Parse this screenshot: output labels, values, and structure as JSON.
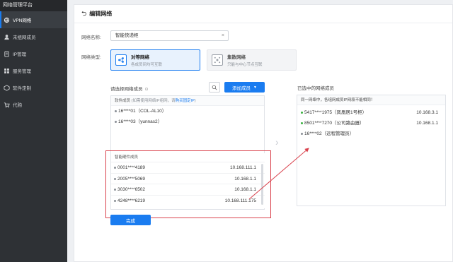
{
  "app": {
    "brand": "网络管理平台"
  },
  "sidebar": {
    "items": [
      {
        "label": "VPN网络",
        "icon": "vpn-icon",
        "active": true
      },
      {
        "label": "未组网成员",
        "icon": "user-icon",
        "active": false
      },
      {
        "label": "IP管理",
        "icon": "ip-icon",
        "active": false
      },
      {
        "label": "服务管理",
        "icon": "service-icon",
        "active": false
      },
      {
        "label": "软件定制",
        "icon": "software-icon",
        "active": false
      },
      {
        "label": "代购",
        "icon": "cart-icon",
        "active": false
      }
    ]
  },
  "header": {
    "back_icon": "back-arrow-icon",
    "title": "编辑网络"
  },
  "form": {
    "name_label": "网络名称:",
    "name_value": "智能快递柜",
    "type_label": "网络类型:",
    "types": [
      {
        "title": "对等网络",
        "subtitle": "各成员间均可互联",
        "selected": true
      },
      {
        "title": "集散网络",
        "subtitle": "只能与中心节点互联",
        "selected": false
      }
    ]
  },
  "members": {
    "title": "请选择网络成员",
    "add_label": "添加成员",
    "software": {
      "header_prefix": "软件成员",
      "header_hint": "(如需使用网络IP组网，请",
      "header_link": "购买固定IP",
      "header_suffix": ")",
      "items": [
        {
          "name": "16****01（COL-AL10）"
        },
        {
          "name": "16****03（yunnas2）"
        }
      ]
    },
    "hardware": {
      "header": "智能硬件成员",
      "items": [
        {
          "id": "0001****4189",
          "ip": "10.168.111.1"
        },
        {
          "id": "2005****5069",
          "ip": "10.168.1.1"
        },
        {
          "id": "3030****6502",
          "ip": "10.168.1.1"
        },
        {
          "id": "4248****6219",
          "ip": "10.168.111.175"
        }
      ]
    },
    "done_label": "完成"
  },
  "selected": {
    "title": "已选中的网络成员",
    "note": "同一网络中，各组网成员IP网段不能相同！",
    "items": [
      {
        "name": "5417****1975（凤凰居1号柜）",
        "ip": "10.168.3.1",
        "online": true
      },
      {
        "name": "8501****7270（公司路由器）",
        "ip": "10.168.1.1",
        "online": true
      },
      {
        "name": "16****02（远程管理员）",
        "ip": "",
        "online": false
      }
    ]
  },
  "colors": {
    "accent": "#1a7cf0",
    "sidebar_bg": "#2e3135",
    "highlight": "#d9414c",
    "online": "#38b03f"
  }
}
